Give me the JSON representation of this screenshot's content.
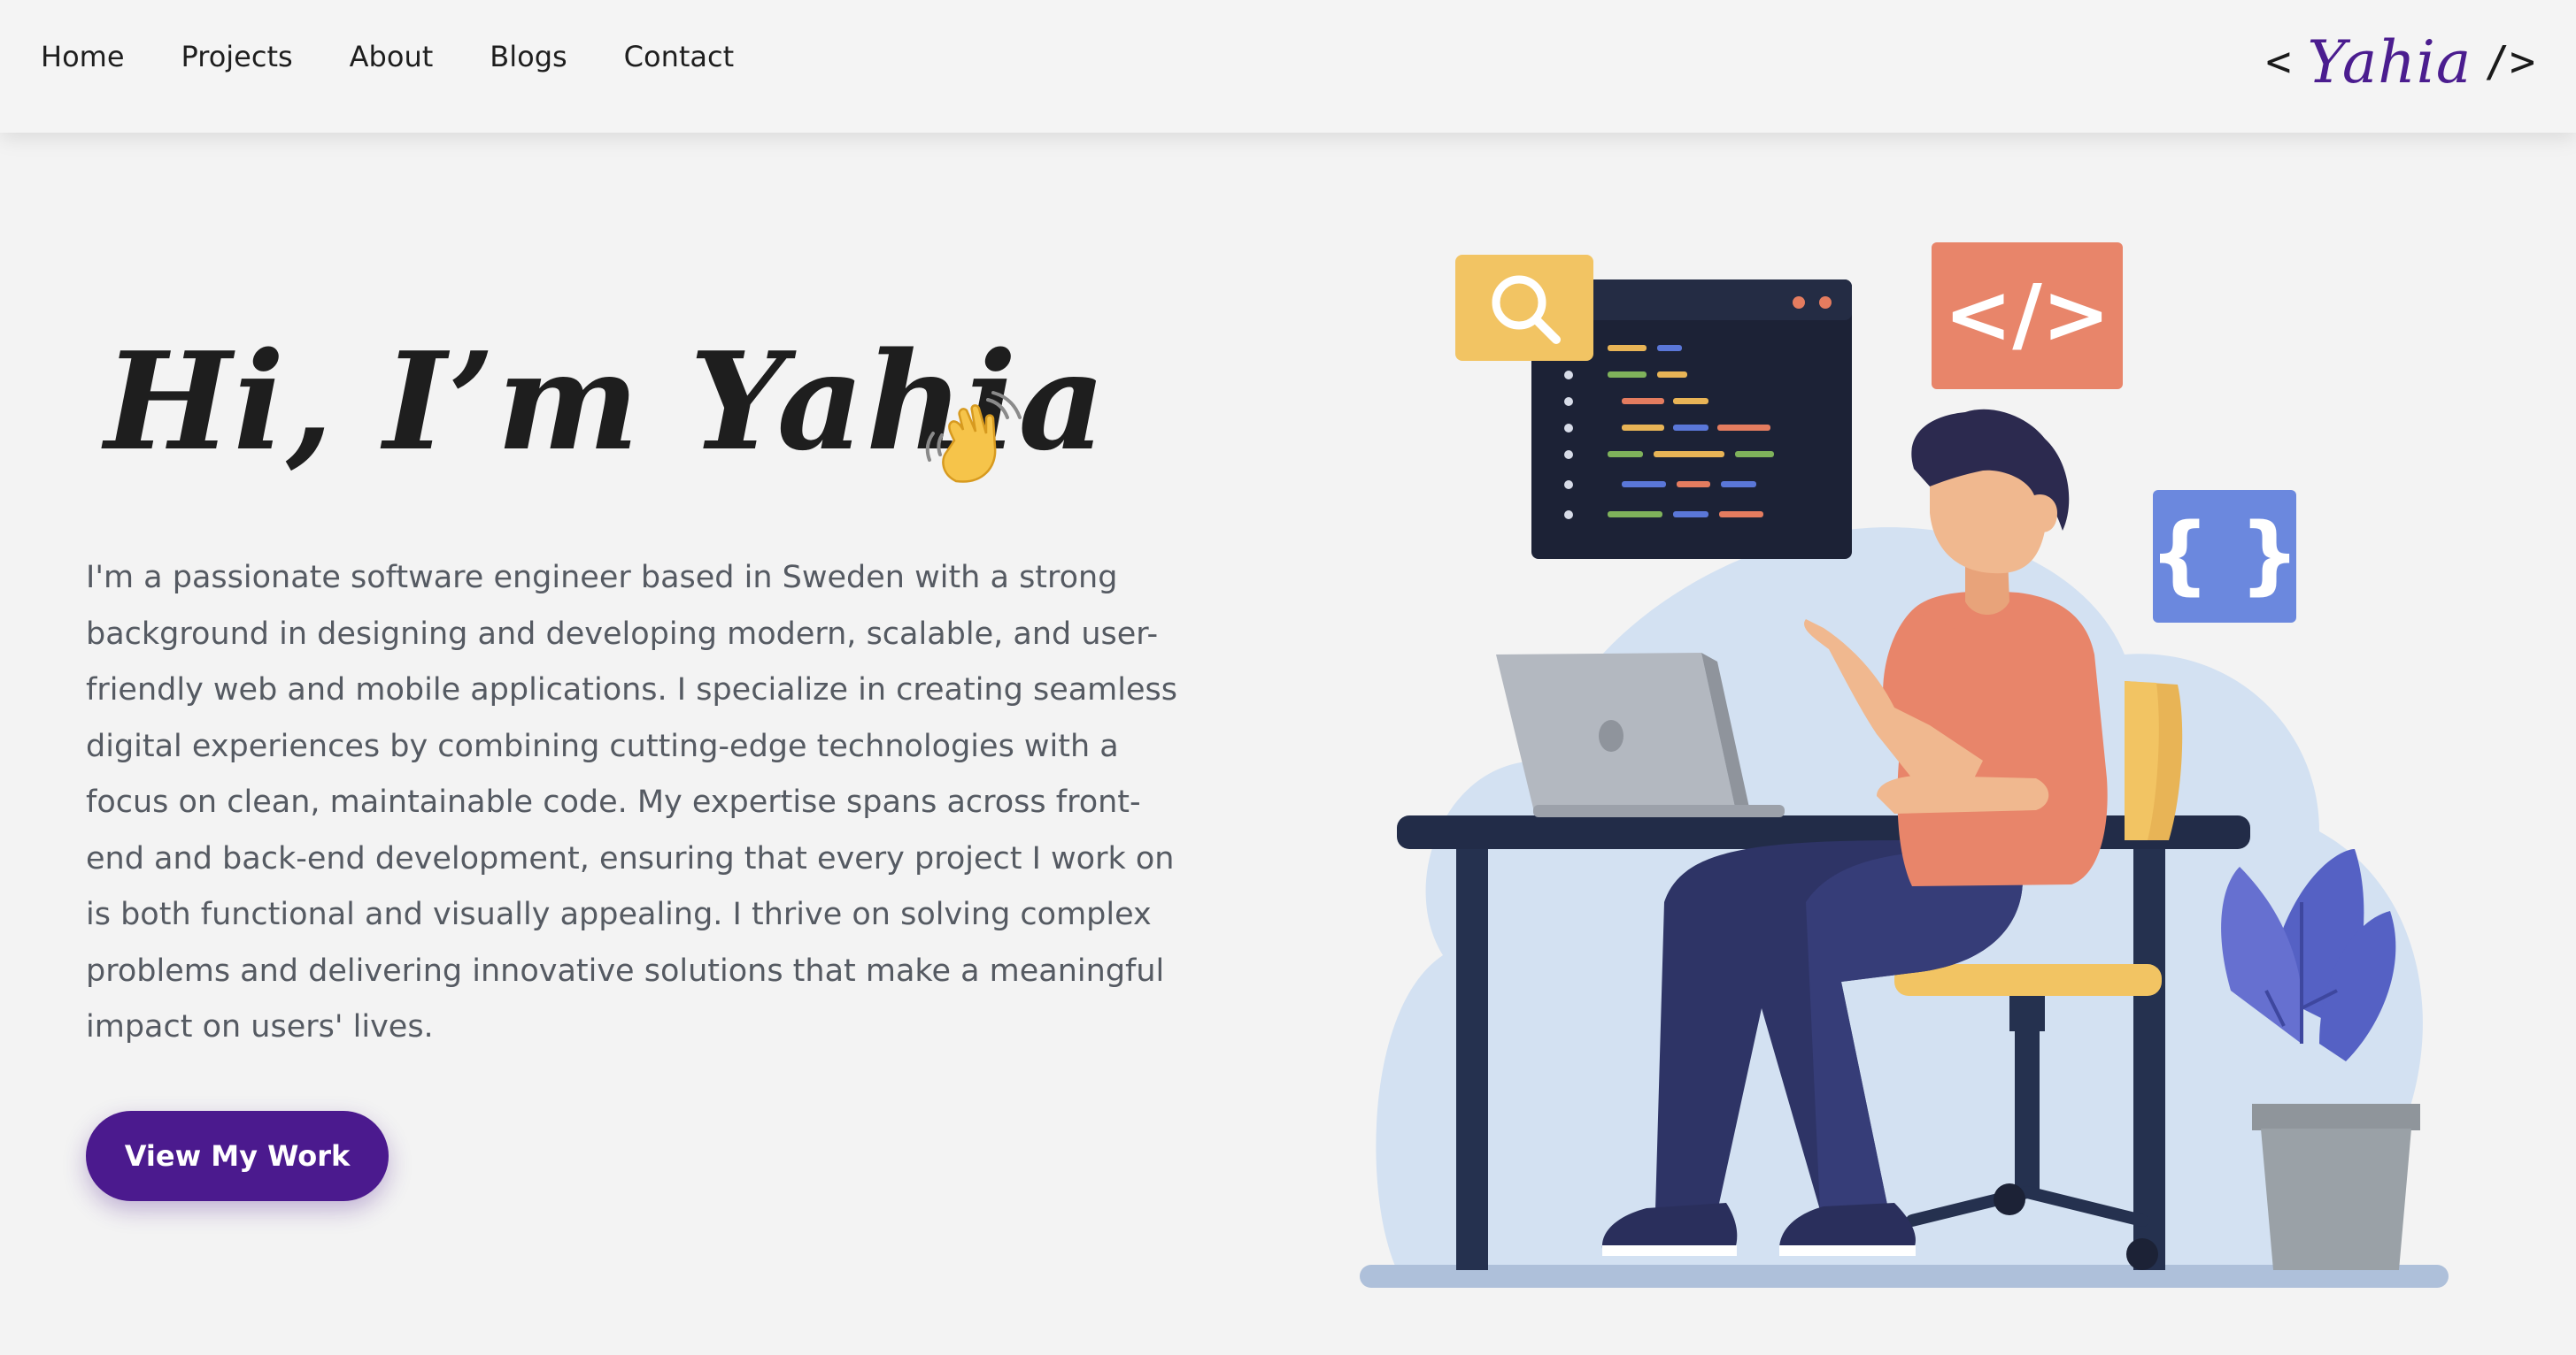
{
  "nav": {
    "links": [
      {
        "label": "Home"
      },
      {
        "label": "Projects"
      },
      {
        "label": "About"
      },
      {
        "label": "Blogs"
      },
      {
        "label": "Contact"
      }
    ],
    "logo": {
      "open": "<",
      "name": "Yahia",
      "close": "/>",
      "name_color": "#4b1d8f"
    }
  },
  "hero": {
    "title": "Hi, I’m Yahia",
    "title_icon": "waving-hand-icon",
    "description": "I'm a passionate software engineer based in Sweden with a strong background in designing and developing modern, scalable, and user-friendly web and mobile applications. I specialize in creating seamless digital experiences by combining cutting-edge technologies with a focus on clean, maintainable code. My expertise spans across front-end and back-end development, ensuring that every project I work on is both functional and visually appealing. I thrive on solving complex problems and delivering innovative solutions that make a meaningful impact on users' lives.",
    "cta_label": "View My Work"
  },
  "illustration": {
    "icons": [
      "search-icon",
      "code-tag-icon",
      "curly-braces-icon",
      "code-window",
      "laptop",
      "developer-person",
      "desk",
      "office-chair",
      "potted-plant"
    ],
    "code_tag_text": "</>",
    "braces_text": "{ }"
  },
  "colors": {
    "background": "#f3f3f3",
    "accent": "#4b1a8e",
    "orange": "#e8856a",
    "yellow": "#f2c463",
    "blue": "#6b88de",
    "blob": "#d3e1f2",
    "navy": "#24305a"
  }
}
